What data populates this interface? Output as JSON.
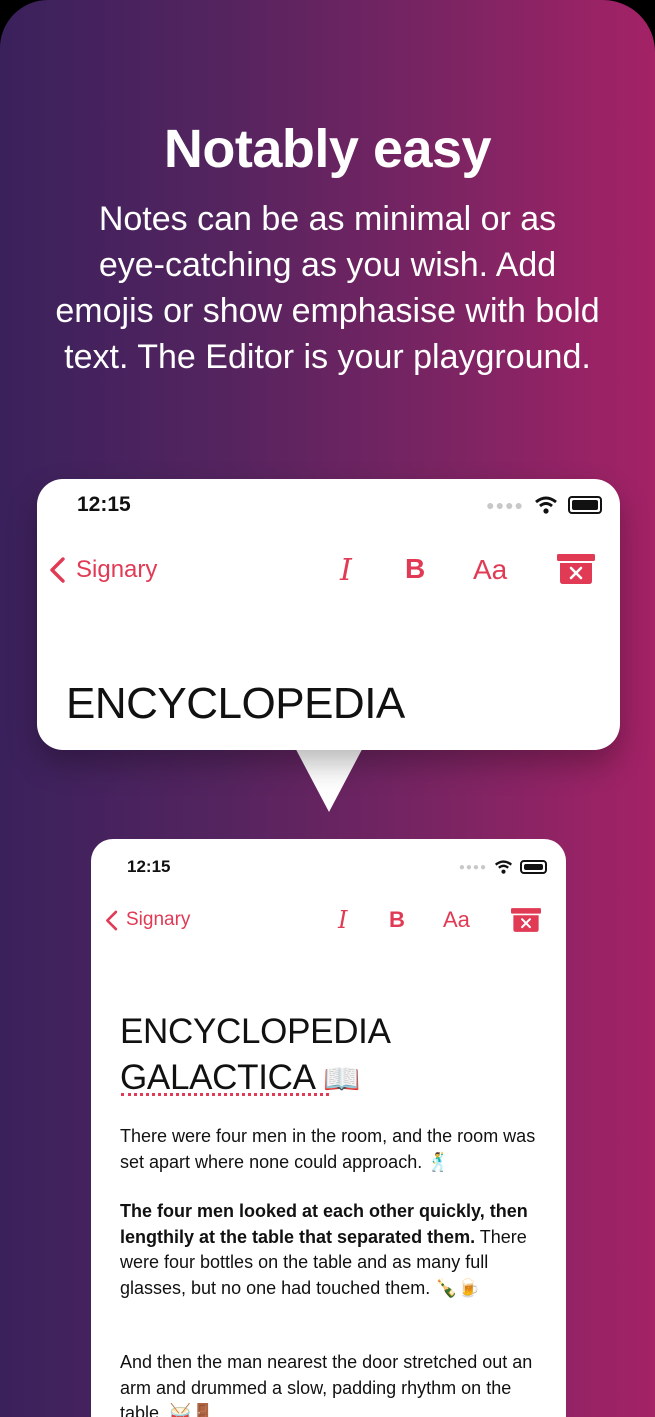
{
  "marketing": {
    "headline": "Notably easy",
    "subtext_lines": [
      "Notes can be as minimal or as",
      "eye-catching as you wish. Add",
      "emojis or show emphasise with bold",
      "text. The Editor is your playground."
    ]
  },
  "zoom": {
    "status_time": "12:15",
    "back_label": "Signary",
    "italic_label": "I",
    "bold_label": "B",
    "font_label": "Aa",
    "title": "ENCYCLOPEDIA"
  },
  "phone": {
    "status_time": "12:15",
    "back_label": "Signary",
    "italic_label": "I",
    "bold_label": "B",
    "font_label": "Aa",
    "title_line1": "ENCYCLOPEDIA",
    "title_line2": "GALACTICA",
    "title_emoji": "📖",
    "p1": "There were four men in the room, and the room was set apart where none could approach.",
    "p1_emoji": "🕺",
    "p2_bold": "The four men looked at each other quickly, then lengthily at the table that separated them.",
    "p2_rest": " There were four bottles on the table and as many full glasses, but no one had touched them.",
    "p2_emoji": "🍾🍺",
    "p3": "And then the man nearest the door stretched out an arm and drummed a slow, padding rhythm on the table.",
    "p3_emoji": "🥁🚪"
  },
  "colors": {
    "accent": "#e03a55",
    "gradient_start": "#3a215c",
    "gradient_end": "#a42266"
  },
  "icons": [
    "back-chevron-icon",
    "wifi-icon",
    "battery-icon",
    "delete-box-icon",
    "book-icon"
  ]
}
